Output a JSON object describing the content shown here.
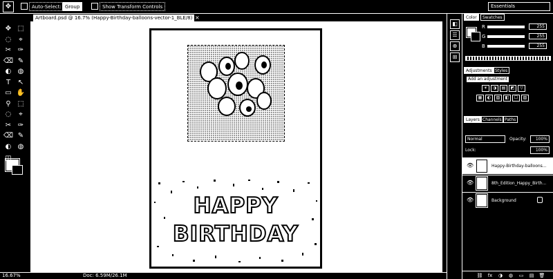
{
  "options_bar": {
    "tool_glyph": "✥",
    "auto_select_label": "Auto-Select:",
    "auto_select_value": "Group",
    "show_transform_label": "Show Transform Controls",
    "workspace": "Essentials"
  },
  "document": {
    "tab_title": "Artboard.psd @ 16.7% (Happy-Birthday-balloons-vector-1_BLE/8)",
    "close_glyph": "×",
    "headline_line1": "HAPPY",
    "headline_line2": "BIRTHDAY"
  },
  "status": {
    "zoom": "16.67%",
    "doc_size": "Doc: 6.59M/26.1M"
  },
  "toolbox": {
    "tools": [
      "✥",
      "⬚",
      "◌",
      "⌖",
      "✂",
      "✑",
      "⌫",
      "✎",
      "◐",
      "◍",
      "T",
      "↖",
      "▭",
      "✋",
      "⚲",
      "⬚",
      "◌",
      "⌖",
      "✂",
      "✑",
      "⌫",
      "✎",
      "◐",
      "◍"
    ],
    "quick_mask": "◫"
  },
  "dock": {
    "icons": [
      "◧",
      "☰",
      "⊕",
      "⊞"
    ]
  },
  "panels": {
    "color_tabs": [
      "Color",
      "Swatches"
    ],
    "sliders": [
      {
        "label": "R",
        "value": "255"
      },
      {
        "label": "G",
        "value": "255"
      },
      {
        "label": "B",
        "value": "255"
      }
    ],
    "adjust_tabs": [
      "Adjustments",
      "Styles"
    ],
    "adjust_title": "Add an adjustment",
    "adjust_icons_row1": [
      "☀",
      "◑",
      "▤",
      "◩",
      "▽"
    ],
    "adjust_icons_row2": [
      "▦",
      "◐",
      "▧",
      "◧",
      "☐",
      "▨"
    ],
    "layer_tabs": [
      "Layers",
      "Channels",
      "Paths"
    ],
    "blend_mode": "Normal",
    "opacity_label": "Opacity:",
    "opacity_value": "100%",
    "lock_label": "Lock:",
    "fill_value": "100%",
    "layers": [
      {
        "name": "Happy-Birthday-balloons...",
        "selected": true
      },
      {
        "name": "8th_Edition_Happy_Birth...",
        "selected": false
      },
      {
        "name": "Background",
        "selected": false
      }
    ],
    "bottom_icons": [
      "⛓",
      "fx",
      "◑",
      "◍",
      "▭",
      "▤",
      "🗑"
    ]
  }
}
